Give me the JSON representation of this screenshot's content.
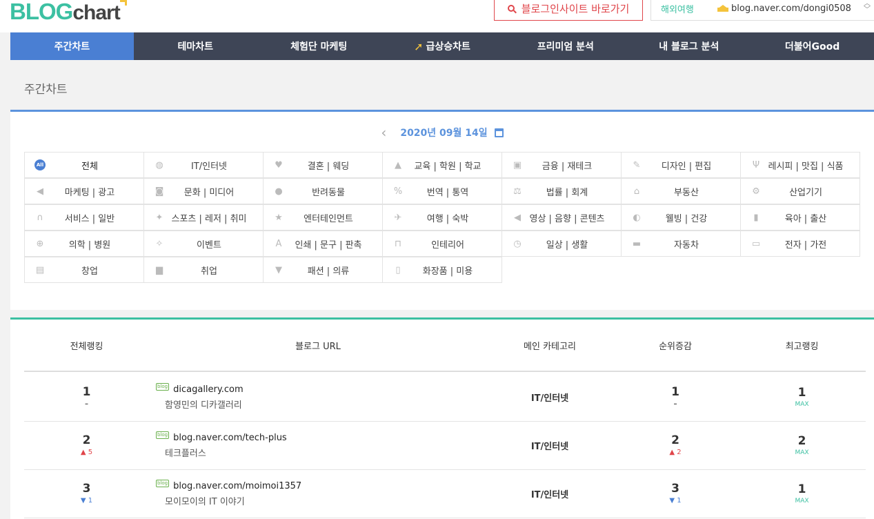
{
  "header": {
    "logo_blog": "BLOG",
    "logo_chart": "chart",
    "insite_button": "블로그인사이트 바로가기",
    "nation": "해외여행",
    "user_url": "blog.naver.com/dongi0508"
  },
  "nav": {
    "items": [
      {
        "label": "주간차트"
      },
      {
        "label": "테마차트"
      },
      {
        "label": "체험단 마케팅"
      },
      {
        "label": "급상승차트"
      },
      {
        "label": "프리미엄 분석"
      },
      {
        "label": "내 블로그 분석"
      },
      {
        "label": "더불어Good"
      }
    ]
  },
  "page": {
    "title": "주간차트",
    "date": "2020년 09월 14일"
  },
  "categories": [
    [
      "전체",
      "IT/인터넷",
      "결혼 | 웨딩",
      "교육 | 학원 | 학교",
      "금융 | 재테크",
      "디자인 | 편집",
      "레시피 | 맛집 | 식품"
    ],
    [
      "마케팅 | 광고",
      "문화 | 미디어",
      "반려동물",
      "번역 | 통역",
      "법률 | 회계",
      "부동산",
      "산업기기"
    ],
    [
      "서비스 | 일반",
      "스포츠 | 레저 | 취미",
      "엔터테인먼트",
      "여행 | 숙박",
      "영상 | 음향 | 콘텐츠",
      "웰빙 | 건강",
      "육아 | 출산"
    ],
    [
      "의학 | 병원",
      "이벤트",
      "인쇄 | 문구 | 판촉",
      "인테리어",
      "일상 | 생활",
      "자동차",
      "전자 | 가전"
    ],
    [
      "창업",
      "취업",
      "패션 | 의류",
      "화장품 | 미용"
    ]
  ],
  "category_icons": [
    [
      "all-icon",
      "globe-icon",
      "heart-icon",
      "graduation-cap-icon",
      "money-icon",
      "pencil-icon",
      "fork-knife-icon"
    ],
    [
      "megaphone-icon",
      "media-icon",
      "paw-icon",
      "translate-icon",
      "scale-icon",
      "house-icon",
      "gear-icon"
    ],
    [
      "headset-icon",
      "sports-icon",
      "star-icon",
      "airplane-icon",
      "speaker-icon",
      "pill-icon",
      "baby-bottle-icon"
    ],
    [
      "medical-cross-icon",
      "party-icon",
      "font-icon",
      "interior-icon",
      "clock-icon",
      "car-icon",
      "monitor-icon"
    ],
    [
      "shop-icon",
      "briefcase-icon",
      "shirt-icon",
      "cosmetics-icon"
    ]
  ],
  "table": {
    "headers": [
      "전체랭킹",
      "블로그 URL",
      "메인 카테고리",
      "순위증감",
      "최고랭킹"
    ],
    "rows": [
      {
        "rank": "1",
        "rank_delta": "–",
        "rank_delta_type": "none",
        "url": "dicagallery.com",
        "name": "함영민의 디카갤러리",
        "category": "IT/인터넷",
        "change": "1",
        "change_delta": "–",
        "change_delta_type": "none",
        "best": "1",
        "best_label": "MAX"
      },
      {
        "rank": "2",
        "rank_delta": "▲ 5",
        "rank_delta_type": "up",
        "url": "blog.naver.com/tech-plus",
        "name": "테크플러스",
        "category": "IT/인터넷",
        "change": "2",
        "change_delta": "▲ 2",
        "change_delta_type": "up",
        "best": "2",
        "best_label": "MAX"
      },
      {
        "rank": "3",
        "rank_delta": "▼ 1",
        "rank_delta_type": "down",
        "url": "blog.naver.com/moimoi1357",
        "name": "모이모이의 IT 이야기",
        "category": "IT/인터넷",
        "change": "3",
        "change_delta": "▼ 1",
        "change_delta_type": "down",
        "best": "1",
        "best_label": "MAX"
      }
    ]
  },
  "blog_badge": "blog",
  "colors": {
    "nav_bg": "#3e4556",
    "nav_active": "#4a7fd3",
    "accent_green": "#3cc0a2",
    "accent_blue": "#5c93dd",
    "insite_red": "#e0454a"
  }
}
